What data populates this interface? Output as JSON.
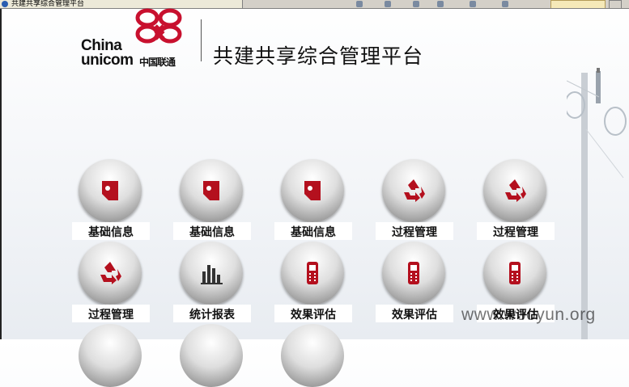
{
  "window": {
    "tab_title": "共建共享综合管理平台"
  },
  "header": {
    "brand_line1": "China",
    "brand_line2": "unicom",
    "brand_cn": "中国联通",
    "title": "共建共享综合管理平台"
  },
  "tiles": [
    {
      "label": "基础信息",
      "icon": "document-icon"
    },
    {
      "label": "基础信息",
      "icon": "document-icon"
    },
    {
      "label": "基础信息",
      "icon": "document-icon"
    },
    {
      "label": "过程管理",
      "icon": "recycle-icon"
    },
    {
      "label": "过程管理",
      "icon": "recycle-icon"
    },
    {
      "label": "过程管理",
      "icon": "recycle-icon"
    },
    {
      "label": "统计报表",
      "icon": "bar-chart-icon"
    },
    {
      "label": "效果评估",
      "icon": "mobile-phone-icon"
    },
    {
      "label": "效果评估",
      "icon": "mobile-phone-icon"
    },
    {
      "label": "效果评估",
      "icon": "mobile-phone-icon"
    }
  ],
  "watermark": "www.wooyun.org",
  "colors": {
    "accent_red": "#b4101e",
    "title_text": "#111111"
  }
}
